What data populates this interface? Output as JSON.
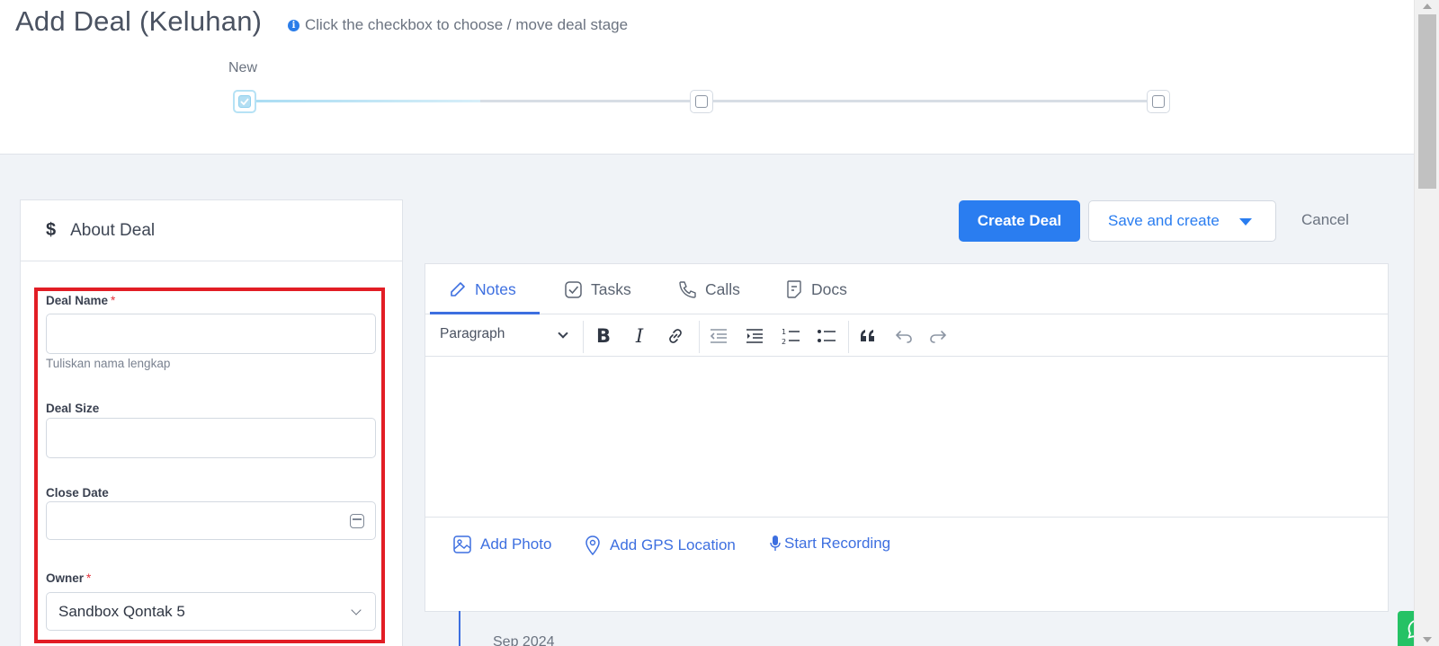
{
  "header": {
    "title": "Add Deal (Keluhan)",
    "hint": "Click the checkbox to choose / move deal stage",
    "stages": [
      {
        "label": "New",
        "active": true
      },
      {
        "label": "",
        "active": false
      },
      {
        "label": "",
        "active": false
      }
    ]
  },
  "about": {
    "title": "About Deal",
    "icon": "dollar-icon",
    "fields": {
      "deal_name": {
        "label": "Deal Name",
        "required_mark": "*",
        "value": "",
        "help": "Tuliskan nama lengkap"
      },
      "deal_size": {
        "label": "Deal Size",
        "value": ""
      },
      "close_date": {
        "label": "Close Date",
        "value": ""
      },
      "owner": {
        "label": "Owner",
        "required_mark": "*",
        "value": "Sandbox Qontak 5"
      }
    }
  },
  "actions": {
    "create": "Create Deal",
    "save": "Save and create",
    "cancel": "Cancel"
  },
  "editor": {
    "tabs": [
      {
        "label": "Notes",
        "icon": "pencil-icon",
        "active": true
      },
      {
        "label": "Tasks",
        "icon": "check-square-icon",
        "active": false
      },
      {
        "label": "Calls",
        "icon": "phone-icon",
        "active": false
      },
      {
        "label": "Docs",
        "icon": "document-icon",
        "active": false
      }
    ],
    "toolbar": {
      "paragraph": "Paragraph"
    },
    "attachments": {
      "photo": "Add Photo",
      "gps": "Add GPS Location",
      "recording": "Start Recording"
    }
  },
  "timeline": {
    "date": "Sep 2024"
  },
  "colors": {
    "primary": "#2a7df0",
    "accent": "#3d6fe0",
    "highlight": "#e21d25",
    "whatsapp": "#25c265"
  }
}
